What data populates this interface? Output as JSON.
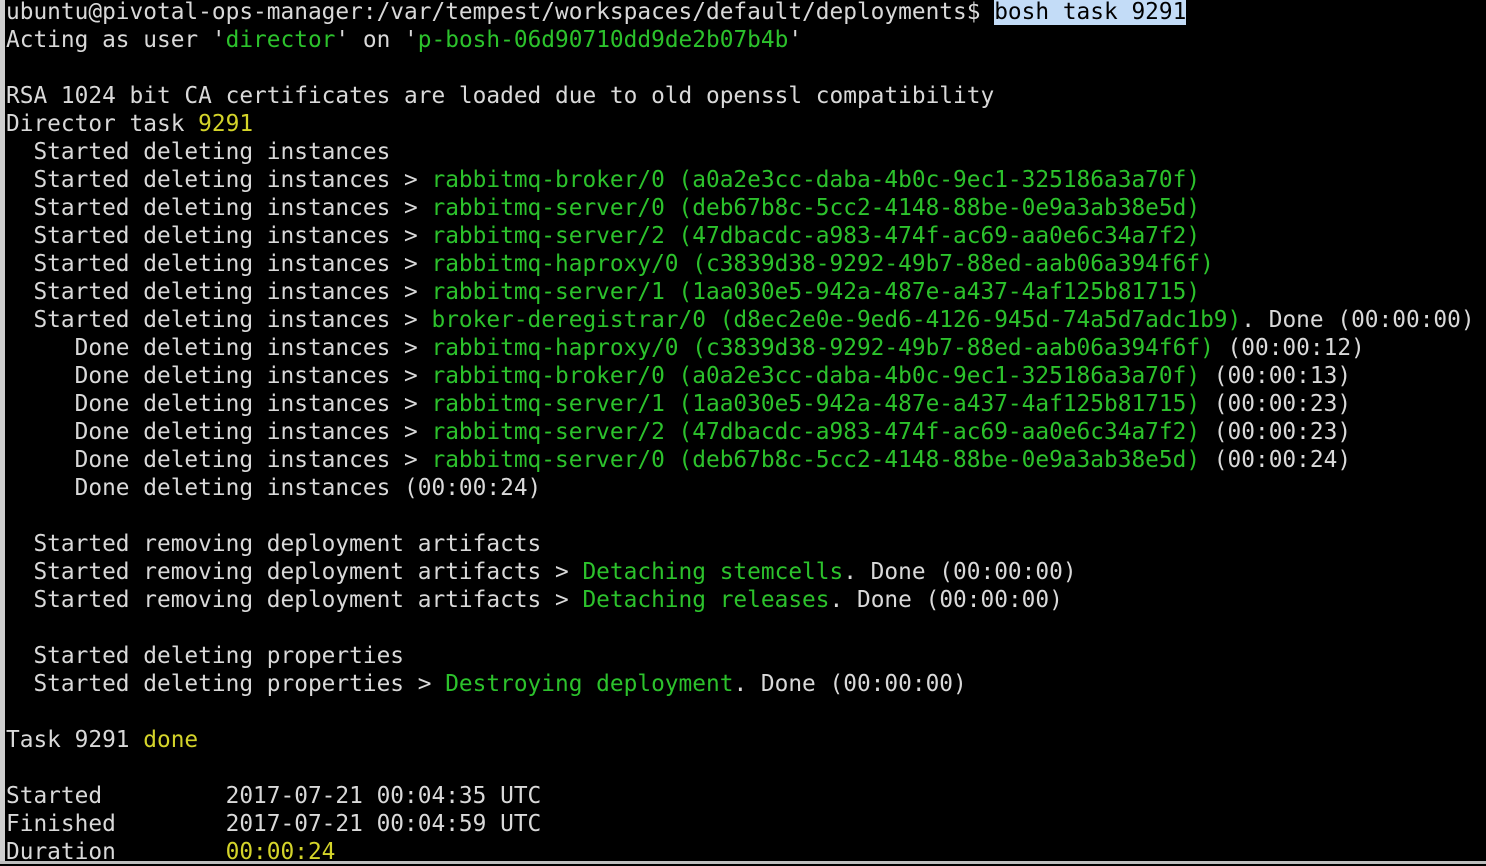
{
  "colors": {
    "text": "#d9d9d9",
    "green": "#2cc22c",
    "yellow": "#d4d42a",
    "selection": "#c3dcf7",
    "background": "#000000"
  },
  "terminal": {
    "lines": [
      [
        [
          "ubuntu@pivotal-ops-manager:/var/tempest/workspaces/default/deployments$ ",
          "w"
        ],
        [
          "bosh task 9291",
          "sel"
        ]
      ],
      [
        [
          "Acting as user '",
          "w"
        ],
        [
          "director",
          "g"
        ],
        [
          "' on '",
          "w"
        ],
        [
          "p-bosh-06d90710dd9de2b07b4b",
          "g"
        ],
        [
          "'",
          "w"
        ]
      ],
      [],
      [
        [
          "RSA 1024 bit CA certificates are loaded due to old openssl compatibility",
          "w"
        ]
      ],
      [
        [
          "Director task ",
          "w"
        ],
        [
          "9291",
          "y"
        ]
      ],
      [
        [
          "  Started deleting instances",
          "w"
        ]
      ],
      [
        [
          "  Started deleting instances > ",
          "w"
        ],
        [
          "rabbitmq-broker/0 (a0a2e3cc-daba-4b0c-9ec1-325186a3a70f)",
          "g"
        ]
      ],
      [
        [
          "  Started deleting instances > ",
          "w"
        ],
        [
          "rabbitmq-server/0 (deb67b8c-5cc2-4148-88be-0e9a3ab38e5d)",
          "g"
        ]
      ],
      [
        [
          "  Started deleting instances > ",
          "w"
        ],
        [
          "rabbitmq-server/2 (47dbacdc-a983-474f-ac69-aa0e6c34a7f2)",
          "g"
        ]
      ],
      [
        [
          "  Started deleting instances > ",
          "w"
        ],
        [
          "rabbitmq-haproxy/0 (c3839d38-9292-49b7-88ed-aab06a394f6f)",
          "g"
        ]
      ],
      [
        [
          "  Started deleting instances > ",
          "w"
        ],
        [
          "rabbitmq-server/1 (1aa030e5-942a-487e-a437-4af125b81715)",
          "g"
        ]
      ],
      [
        [
          "  Started deleting instances > ",
          "w"
        ],
        [
          "broker-deregistrar/0 (d8ec2e0e-9ed6-4126-945d-74a5d7adc1b9)",
          "g"
        ],
        [
          ". Done (00:00:00)",
          "w"
        ]
      ],
      [
        [
          "     Done deleting instances > ",
          "w"
        ],
        [
          "rabbitmq-haproxy/0 (c3839d38-9292-49b7-88ed-aab06a394f6f)",
          "g"
        ],
        [
          " (00:00:12)",
          "w"
        ]
      ],
      [
        [
          "     Done deleting instances > ",
          "w"
        ],
        [
          "rabbitmq-broker/0 (a0a2e3cc-daba-4b0c-9ec1-325186a3a70f)",
          "g"
        ],
        [
          " (00:00:13)",
          "w"
        ]
      ],
      [
        [
          "     Done deleting instances > ",
          "w"
        ],
        [
          "rabbitmq-server/1 (1aa030e5-942a-487e-a437-4af125b81715)",
          "g"
        ],
        [
          " (00:00:23)",
          "w"
        ]
      ],
      [
        [
          "     Done deleting instances > ",
          "w"
        ],
        [
          "rabbitmq-server/2 (47dbacdc-a983-474f-ac69-aa0e6c34a7f2)",
          "g"
        ],
        [
          " (00:00:23)",
          "w"
        ]
      ],
      [
        [
          "     Done deleting instances > ",
          "w"
        ],
        [
          "rabbitmq-server/0 (deb67b8c-5cc2-4148-88be-0e9a3ab38e5d)",
          "g"
        ],
        [
          " (00:00:24)",
          "w"
        ]
      ],
      [
        [
          "     Done deleting instances (00:00:24)",
          "w"
        ]
      ],
      [],
      [
        [
          "  Started removing deployment artifacts",
          "w"
        ]
      ],
      [
        [
          "  Started removing deployment artifacts > ",
          "w"
        ],
        [
          "Detaching stemcells",
          "g"
        ],
        [
          ". Done (00:00:00)",
          "w"
        ]
      ],
      [
        [
          "  Started removing deployment artifacts > ",
          "w"
        ],
        [
          "Detaching releases",
          "g"
        ],
        [
          ". Done (00:00:00)",
          "w"
        ]
      ],
      [],
      [
        [
          "  Started deleting properties",
          "w"
        ]
      ],
      [
        [
          "  Started deleting properties > ",
          "w"
        ],
        [
          "Destroying deployment",
          "g"
        ],
        [
          ". Done (00:00:00)",
          "w"
        ]
      ],
      [],
      [
        [
          "Task 9291 ",
          "w"
        ],
        [
          "done",
          "y"
        ]
      ],
      [],
      [
        [
          "Started         2017-07-21 00:04:35 UTC",
          "w"
        ]
      ],
      [
        [
          "Finished        2017-07-21 00:04:59 UTC",
          "w"
        ]
      ],
      [
        [
          "Duration        ",
          "w"
        ],
        [
          "00:00:24",
          "y"
        ]
      ]
    ]
  }
}
